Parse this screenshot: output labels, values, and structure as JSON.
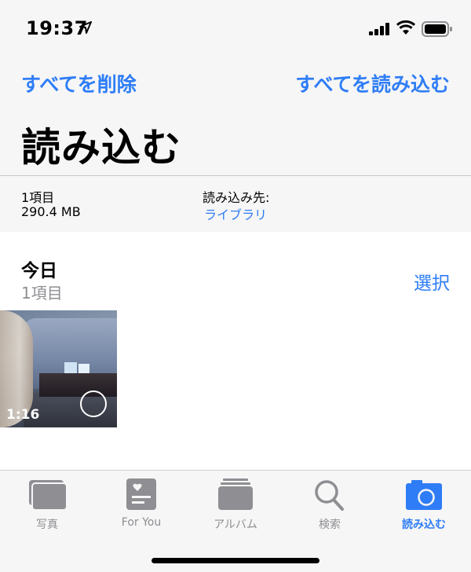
{
  "status": {
    "time": "19:37"
  },
  "header": {
    "delete_all": "すべてを削除",
    "import_all": "すべてを読み込む",
    "title": "読み込む"
  },
  "info": {
    "count": "1項目",
    "size": "290.4 MB",
    "destination_label": "読み込み先:",
    "destination_value": "ライブラリ"
  },
  "section": {
    "title": "今日",
    "count": "1項目",
    "select_label": "選択"
  },
  "media": [
    {
      "duration": "1:16"
    }
  ],
  "tabs": [
    {
      "label": "写真",
      "icon": "photos-icon",
      "active": false
    },
    {
      "label": "For You",
      "icon": "for-you-icon",
      "active": false
    },
    {
      "label": "アルバム",
      "icon": "albums-icon",
      "active": false
    },
    {
      "label": "検索",
      "icon": "search-icon",
      "active": false
    },
    {
      "label": "読み込む",
      "icon": "import-camera-icon",
      "active": true
    }
  ],
  "colors": {
    "accent": "#2f7df6",
    "inactive": "#8e8e93"
  }
}
